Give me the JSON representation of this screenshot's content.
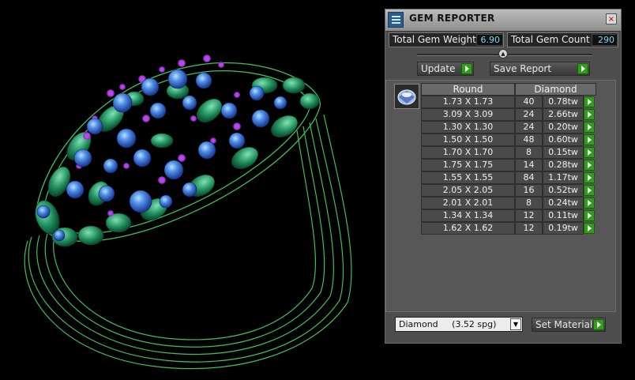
{
  "panel": {
    "title": "GEM REPORTER",
    "close_label": "×",
    "total_weight": {
      "label": "Total Gem Weight",
      "value": "6.90"
    },
    "total_count": {
      "label": "Total Gem Count",
      "value": "290"
    },
    "update_label": "Update",
    "save_report_label": "Save Report",
    "table": {
      "headers": [
        "Round",
        "Diamond"
      ],
      "rows": [
        {
          "size": "1.73 X 1.73",
          "count": "40",
          "weight": "0.78tw"
        },
        {
          "size": "3.09 X 3.09",
          "count": "24",
          "weight": "2.66tw"
        },
        {
          "size": "1.30 X 1.30",
          "count": "24",
          "weight": "0.20tw"
        },
        {
          "size": "1.50 X 1.50",
          "count": "48",
          "weight": "0.60tw"
        },
        {
          "size": "1.70 X 1.70",
          "count": "8",
          "weight": "0.15tw"
        },
        {
          "size": "1.75 X 1.75",
          "count": "14",
          "weight": "0.28tw"
        },
        {
          "size": "1.55 X 1.55",
          "count": "84",
          "weight": "1.17tw"
        },
        {
          "size": "2.05 X 2.05",
          "count": "16",
          "weight": "0.52tw"
        },
        {
          "size": "2.01 X 2.01",
          "count": "8",
          "weight": "0.24tw"
        },
        {
          "size": "1.34 X 1.34",
          "count": "12",
          "weight": "0.11tw"
        },
        {
          "size": "1.62 X 1.62",
          "count": "12",
          "weight": "0.19tw"
        }
      ]
    },
    "material_select": "Diamond     (3.52 spg)",
    "set_material_label": "Set Material"
  },
  "icons": {
    "app": "gem-reporter-icon",
    "gem": "round-gem-icon",
    "go": "green-arrow-icon",
    "dropdown": "chevron-down-icon"
  },
  "colors": {
    "panel_bg": "#4d4d4d",
    "value_text": "#7fd6ee",
    "go_button": "#2e9e1b",
    "wireframe": "#3fbf5a",
    "gem_blue": "#3c73d6",
    "prong_purple": "#9b2fd1"
  }
}
